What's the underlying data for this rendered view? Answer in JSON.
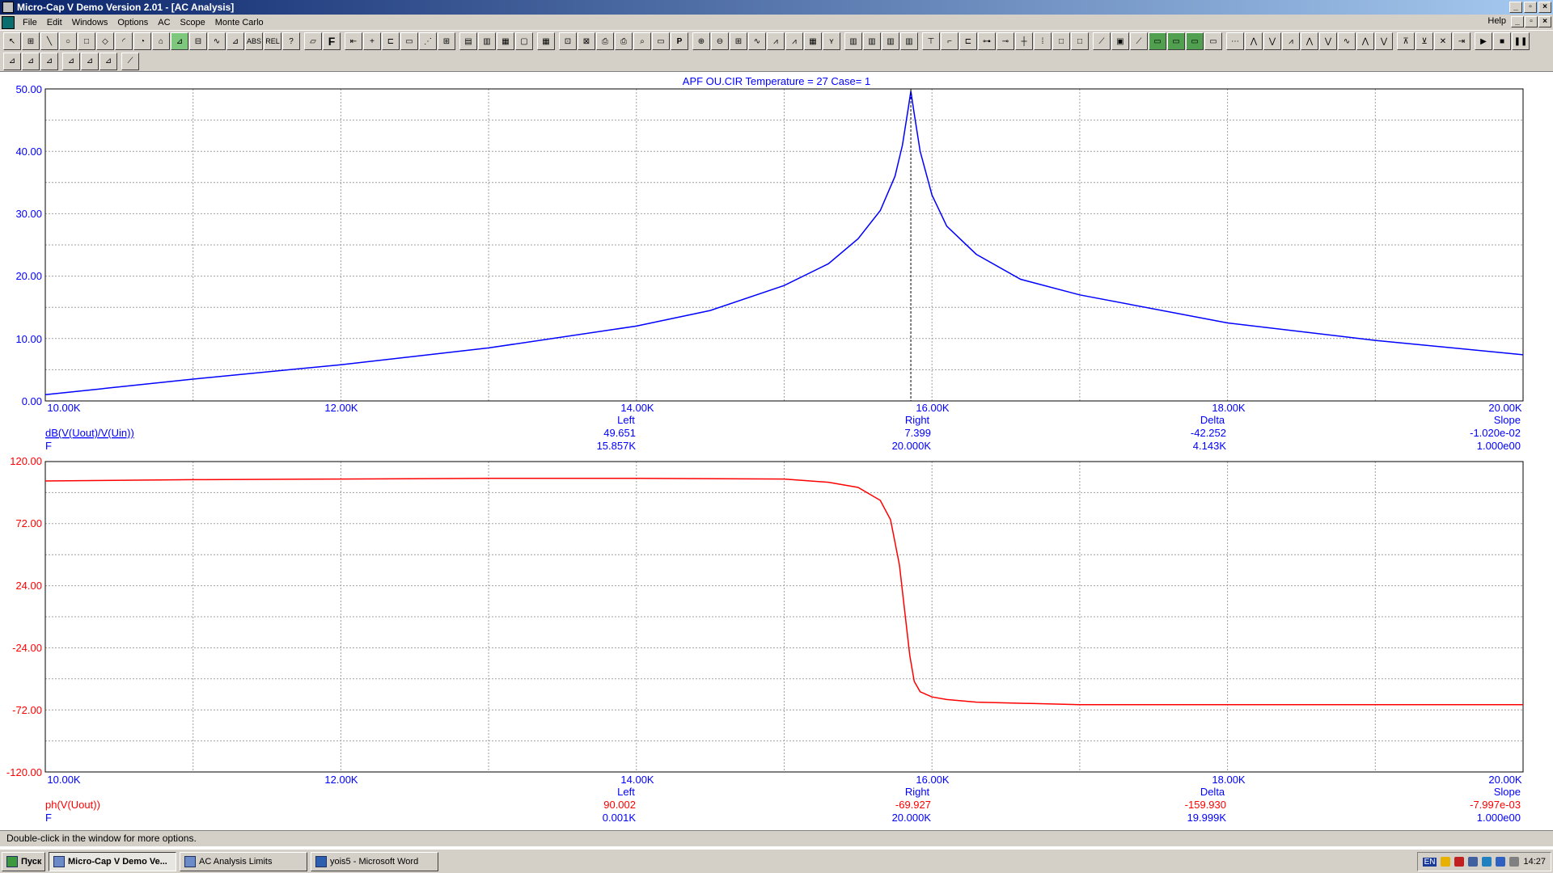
{
  "window": {
    "title": "Micro-Cap V Demo Version 2.01 - [AC Analysis]"
  },
  "menu": {
    "items": [
      "File",
      "Edit",
      "Windows",
      "Options",
      "AC",
      "Scope",
      "Monte Carlo"
    ],
    "help": "Help"
  },
  "toolbar": {
    "abs_label": "ABS",
    "rel_label": "REL",
    "help_label": "?",
    "f_label": "F",
    "p_label": "P"
  },
  "plot": {
    "header": "APF  OU.CIR Temperature = 27 Case= 1",
    "top": {
      "yticks": [
        "50.00",
        "40.00",
        "30.00",
        "20.00",
        "10.00",
        "0.00"
      ],
      "xticks": [
        "10.00K",
        "12.00K",
        "14.00K",
        "16.00K",
        "18.00K",
        "20.00K"
      ],
      "cursor_headers": [
        "Left",
        "Right",
        "Delta",
        "Slope"
      ],
      "rows": [
        {
          "name": "dB(V(Uout)/V(Uin))",
          "left": "49.651",
          "right": "7.399",
          "delta": "-42.252",
          "slope": "-1.020e-02"
        },
        {
          "name": "F",
          "left": "15.857K",
          "right": "20.000K",
          "delta": "4.143K",
          "slope": "1.000e00"
        }
      ],
      "color": "#0000ff"
    },
    "bottom": {
      "yticks": [
        "120.00",
        "72.00",
        "24.00",
        "-24.00",
        "-72.00",
        "-120.00"
      ],
      "xticks": [
        "10.00K",
        "12.00K",
        "14.00K",
        "16.00K",
        "18.00K",
        "20.00K"
      ],
      "cursor_headers": [
        "Left",
        "Right",
        "Delta",
        "Slope"
      ],
      "rows": [
        {
          "name": "ph(V(Uout))",
          "left": "90.002",
          "right": "-69.927",
          "delta": "-159.930",
          "slope": "-7.997e-03"
        },
        {
          "name": "F",
          "left": "0.001K",
          "right": "20.000K",
          "delta": "19.999K",
          "slope": "1.000e00"
        }
      ],
      "color": "#ff0000"
    }
  },
  "chart_data": [
    {
      "type": "line",
      "title": "APF  OU.CIR Temperature = 27 Case= 1",
      "xlabel": "F",
      "ylabel": "dB(V(Uout)/V(Uin))",
      "xlim": [
        10000,
        20000
      ],
      "ylim": [
        0,
        50
      ],
      "grid": true,
      "series": [
        {
          "name": "dB(V(Uout)/V(Uin))",
          "color": "#0000ff",
          "x": [
            10000,
            11000,
            12000,
            13000,
            14000,
            14500,
            15000,
            15300,
            15500,
            15650,
            15750,
            15800,
            15840,
            15857,
            15880,
            15920,
            16000,
            16100,
            16300,
            16600,
            17000,
            18000,
            19000,
            20000
          ],
          "y": [
            1.0,
            3.5,
            5.8,
            8.5,
            12.0,
            14.5,
            18.5,
            22.0,
            26.0,
            30.5,
            36.0,
            41.0,
            47.0,
            49.651,
            46.0,
            40.0,
            33.0,
            28.0,
            23.5,
            19.5,
            17.0,
            12.5,
            9.7,
            7.399
          ]
        }
      ]
    },
    {
      "type": "line",
      "xlabel": "F",
      "ylabel": "ph(V(Uout))",
      "xlim": [
        10000,
        20000
      ],
      "ylim": [
        -120,
        120
      ],
      "grid": true,
      "series": [
        {
          "name": "ph(V(Uout))",
          "color": "#ff0000",
          "x": [
            10000,
            11000,
            12000,
            13000,
            14000,
            15000,
            15300,
            15500,
            15650,
            15720,
            15780,
            15820,
            15850,
            15880,
            15920,
            16000,
            16100,
            16300,
            17000,
            18000,
            19000,
            20000
          ],
          "y": [
            105,
            106,
            106.5,
            107,
            107,
            106.5,
            104,
            100,
            90,
            75,
            40,
            0,
            -30,
            -50,
            -58,
            -62,
            -64,
            -66,
            -68,
            -68,
            -68,
            -68
          ]
        }
      ]
    }
  ],
  "status": {
    "text": "Double-click in the window for more options."
  },
  "taskbar": {
    "start": "Пуск",
    "tasks": [
      "Micro-Cap V Demo Ve...",
      "AC Analysis Limits",
      "yois5 - Microsoft Word"
    ],
    "lang": "EN",
    "clock": "14:27"
  }
}
